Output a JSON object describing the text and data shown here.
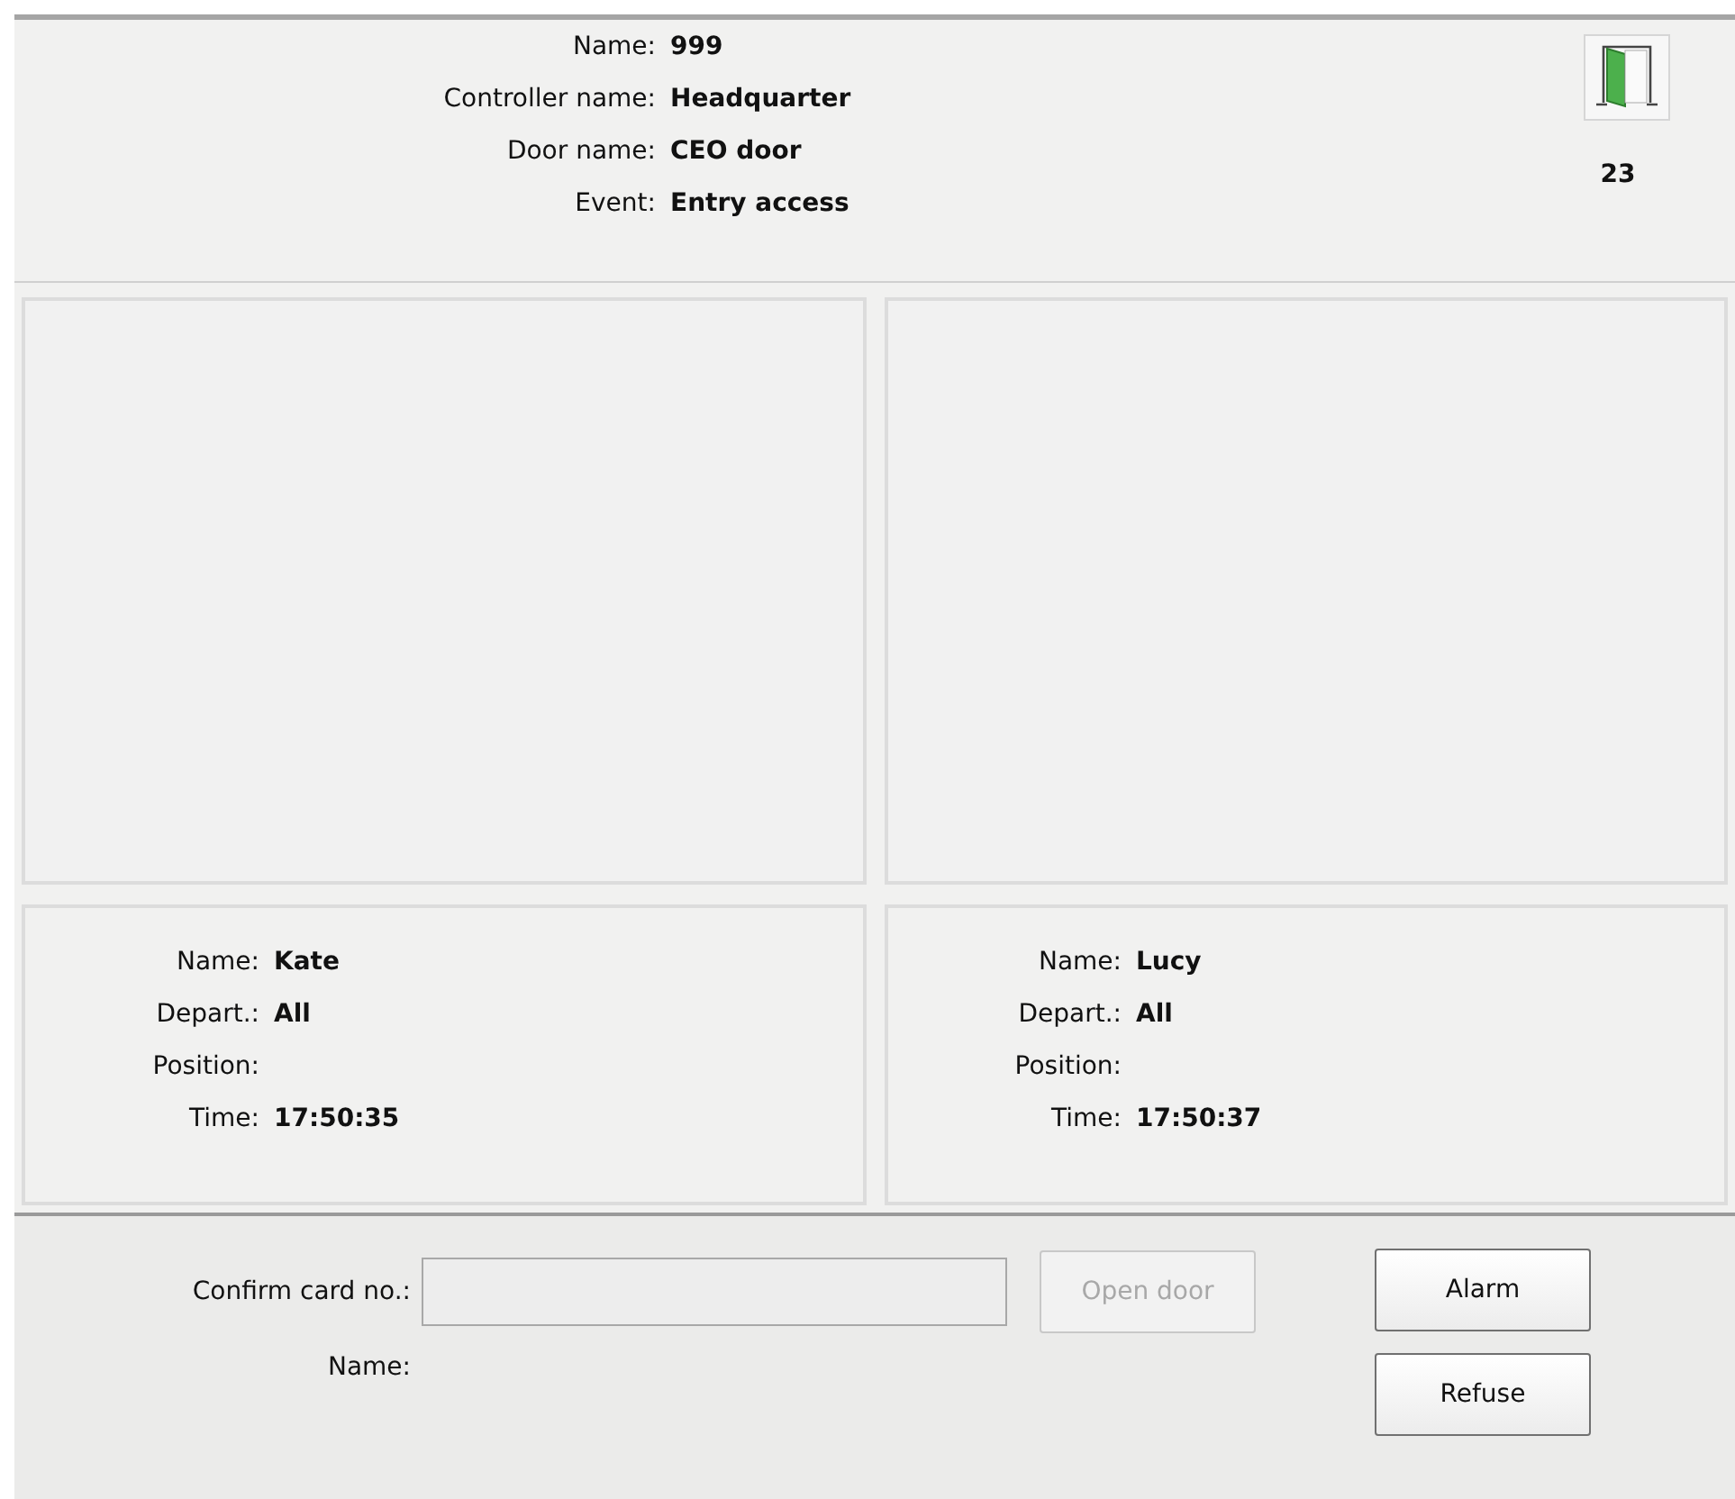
{
  "event_info": [
    {
      "label": "Name:",
      "value": "999"
    },
    {
      "label": "Controller name:",
      "value": "Headquarter"
    },
    {
      "label": "Door name:",
      "value": "CEO door"
    },
    {
      "label": "Event:",
      "value": "Entry access"
    }
  ],
  "door_count": "23",
  "persons": [
    {
      "fields": [
        {
          "label": "Name:",
          "value": "Kate"
        },
        {
          "label": "Depart.:",
          "value": "All"
        },
        {
          "label": "Position:"
        },
        {
          "label": "Time:",
          "value": "17:50:35"
        }
      ]
    },
    {
      "fields": [
        {
          "label": "Name:",
          "value": "Lucy"
        },
        {
          "label": "Depart.:",
          "value": "All"
        },
        {
          "label": "Position:"
        },
        {
          "label": "Time:",
          "value": "17:50:37"
        }
      ]
    }
  ],
  "confirm": {
    "label": "Confirm card no.:",
    "name_label": "Name:",
    "open_door": {
      "label": "Open door",
      "disabled": true
    }
  },
  "buttons": [
    "Alarm",
    "Refuse"
  ]
}
